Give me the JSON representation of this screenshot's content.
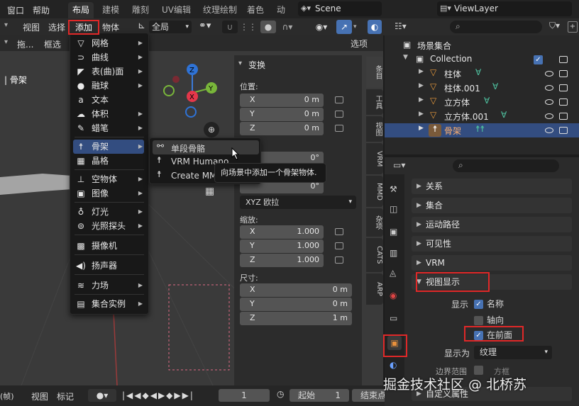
{
  "topbar": {
    "menus": [
      "窗口",
      "帮助"
    ],
    "tabs": [
      "布局",
      "建模",
      "雕刻",
      "UV编辑",
      "纹理绘制",
      "着色",
      "动画"
    ],
    "active_tab": "布局",
    "scene": "Scene",
    "view_layer": "ViewLayer"
  },
  "viewport_header": {
    "items": [
      "视图",
      "选择",
      "添加",
      "物体"
    ],
    "transform_orientation": "全局",
    "options_label": "选项",
    "tool": "框选",
    "drag": "拖..."
  },
  "viewport": {
    "object_label": "| 骨架"
  },
  "add_menu": {
    "items": [
      {
        "label": "网格",
        "icon": "mesh-icon",
        "sub": true
      },
      {
        "label": "曲线",
        "icon": "curve-icon",
        "sub": true
      },
      {
        "label": "表(曲)面",
        "icon": "surface-icon",
        "sub": true
      },
      {
        "label": "融球",
        "icon": "metaball-icon",
        "sub": true
      },
      {
        "label": "文本",
        "icon": "text-icon",
        "sub": false
      },
      {
        "label": "体积",
        "icon": "volume-icon",
        "sub": true
      },
      {
        "label": "蜡笔",
        "icon": "grease-pencil-icon",
        "sub": true
      },
      {
        "label": "骨架",
        "icon": "armature-icon",
        "sub": true
      },
      {
        "label": "晶格",
        "icon": "lattice-icon",
        "sub": false
      },
      {
        "label": "空物体",
        "icon": "empty-icon",
        "sub": true
      },
      {
        "label": "图像",
        "icon": "image-icon",
        "sub": true
      },
      {
        "label": "灯光",
        "icon": "light-icon",
        "sub": true
      },
      {
        "label": "光照探头",
        "icon": "light-probe-icon",
        "sub": true
      },
      {
        "label": "摄像机",
        "icon": "camera-icon",
        "sub": false
      },
      {
        "label": "扬声器",
        "icon": "speaker-icon",
        "sub": false
      },
      {
        "label": "力场",
        "icon": "force-field-icon",
        "sub": true
      },
      {
        "label": "集合实例",
        "icon": "collection-instance-icon",
        "sub": true
      }
    ]
  },
  "armature_submenu": {
    "items": [
      "单段骨骼",
      "VRM Humanoid",
      "Create MM"
    ]
  },
  "tooltip": "向场景中添加一个骨架物体.",
  "npanel": {
    "title": "变换",
    "location_label": "位置:",
    "rotation_mode": "XYZ 欧拉",
    "scale_label": "缩放:",
    "dims_label": "尺寸:",
    "location": [
      {
        "k": "X",
        "v": "0 m"
      },
      {
        "k": "Y",
        "v": "0 m"
      },
      {
        "k": "Z",
        "v": "0 m"
      }
    ],
    "rotation": [
      {
        "k": "",
        "v": "0°"
      },
      {
        "k": "",
        "v": "0°"
      }
    ],
    "scale": [
      {
        "k": "X",
        "v": "1.000"
      },
      {
        "k": "Y",
        "v": "1.000"
      },
      {
        "k": "Z",
        "v": "1.000"
      }
    ],
    "dims": [
      {
        "k": "X",
        "v": "0 m"
      },
      {
        "k": "Y",
        "v": "0 m"
      },
      {
        "k": "Z",
        "v": "1 m"
      }
    ],
    "tabs": [
      "条目",
      "工具",
      "视图",
      "VRM",
      "MMD",
      "杂项",
      "CATS",
      "ARP"
    ]
  },
  "outliner": {
    "root": "场景集合",
    "collection": "Collection",
    "rows": [
      "柱体",
      "柱体.001",
      "立方体",
      "立方体.001",
      "骨架"
    ]
  },
  "properties": {
    "panels": [
      "关系",
      "集合",
      "运动路径",
      "可见性",
      "VRM",
      "视图显示"
    ],
    "display_label": "显示",
    "name_label": "名称",
    "axes_label": "轴向",
    "in_front_label": "在前面",
    "display_as_label": "显示为",
    "display_as_value": "纹理",
    "bounds_label": "边界范围",
    "bounds_value": "方框",
    "custom_props": "自定义属性"
  },
  "timeline": {
    "items": [
      "视图",
      "标记"
    ],
    "frame": "1",
    "start_label": "起始",
    "start": "1",
    "end_label": "结束点",
    "left": "(帧)"
  },
  "watermark": "掘金技术社区 @ 北桥苏",
  "colors": {
    "highlight": "#334d80",
    "accent": "#4772b3",
    "red": "#e02828",
    "bone": "#4fc2a0"
  }
}
